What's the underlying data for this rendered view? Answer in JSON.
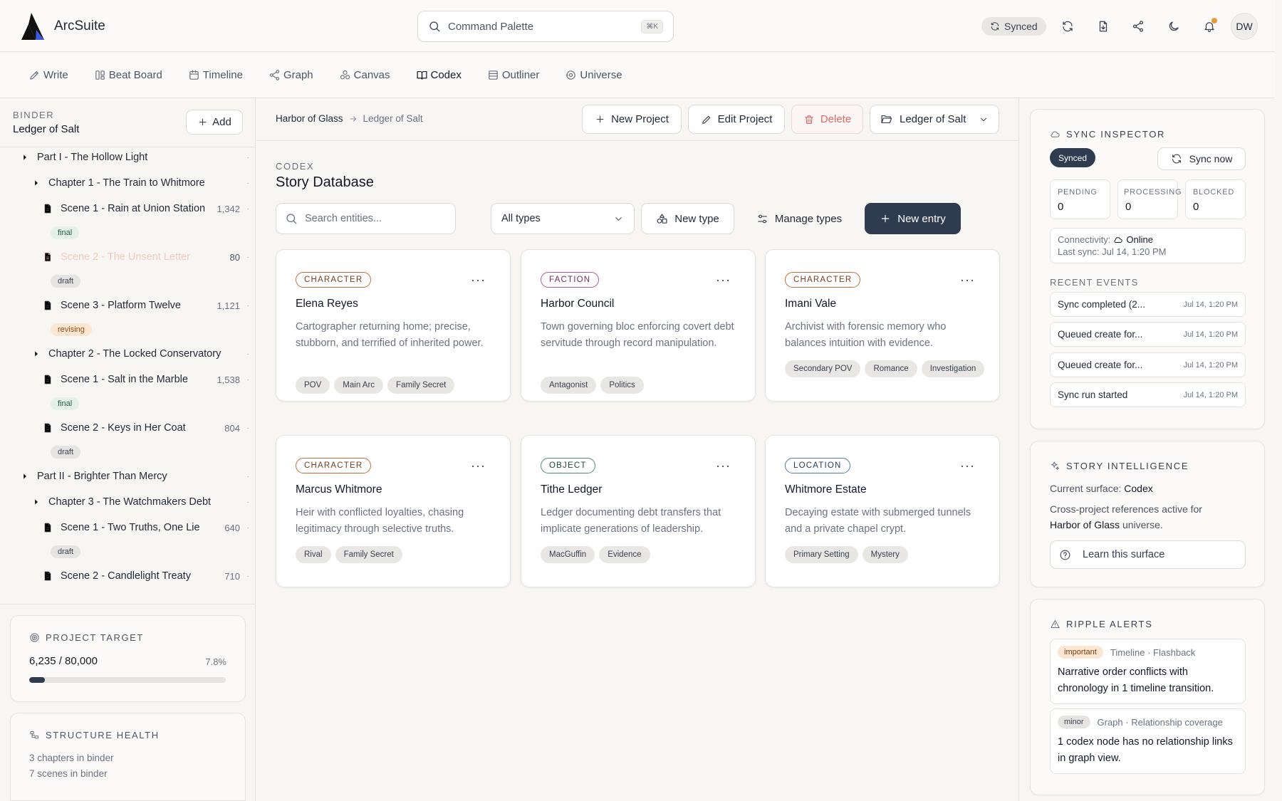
{
  "app": {
    "name": "ArcSuite",
    "user_initials": "DW",
    "sync_status": "Synced"
  },
  "command_palette": {
    "label": "Command Palette",
    "shortcut": "⌘K"
  },
  "nav": {
    "tabs": [
      {
        "label": "Write",
        "icon": "pen-icon"
      },
      {
        "label": "Beat Board",
        "icon": "board-icon"
      },
      {
        "label": "Timeline",
        "icon": "calendar-icon"
      },
      {
        "label": "Graph",
        "icon": "graph-icon"
      },
      {
        "label": "Canvas",
        "icon": "canvas-icon"
      },
      {
        "label": "Codex",
        "icon": "book-icon",
        "active": true
      },
      {
        "label": "Outliner",
        "icon": "outline-icon"
      },
      {
        "label": "Universe",
        "icon": "universe-icon"
      }
    ]
  },
  "binder": {
    "label": "BINDER",
    "title": "Ledger of Salt",
    "add_label": "Add",
    "items": [
      {
        "label": "Part I - The Hollow Light"
      },
      {
        "label": "Chapter 1 - The Train to Whitmore"
      },
      {
        "label": "Scene 1 - Rain at Union Station",
        "count": "1,342",
        "status": "final"
      },
      {
        "label": "Scene 2 - The Unsent Letter",
        "count": "80",
        "status": "draft"
      },
      {
        "label": "Scene 3 - Platform Twelve",
        "count": "1,121",
        "status": "revising"
      },
      {
        "label": "Chapter 2 - The Locked Conservatory"
      },
      {
        "label": "Scene 1 - Salt in the Marble",
        "count": "1,538",
        "status": "final"
      },
      {
        "label": "Scene 2 - Keys in Her Coat",
        "count": "804",
        "status": "draft"
      },
      {
        "label": "Part II - Brighter Than Mercy"
      },
      {
        "label": "Chapter 3 - The Watchmakers Debt"
      },
      {
        "label": "Scene 1 - Two Truths, One Lie",
        "count": "640",
        "status": "draft"
      },
      {
        "label": "Scene 2 - Candlelight Treaty",
        "count": "710"
      }
    ],
    "dot": "·",
    "project_target": {
      "title": "PROJECT TARGET",
      "progress": "6,235 / 80,000",
      "percent": "7.8%",
      "fraction": 0.078
    },
    "structure_health": {
      "title": "STRUCTURE HEALTH",
      "chapters": "3 chapters in binder",
      "scenes": "7 scenes in binder"
    }
  },
  "main": {
    "breadcrumb": {
      "root": "Harbor of Glass",
      "current": "Ledger of Salt"
    },
    "toolbar": {
      "new_project": "New Project",
      "edit_project": "Edit Project",
      "delete": "Delete",
      "project_select": "Ledger of Salt"
    },
    "eyebrow": "CODEX",
    "title": "Story Database",
    "search_placeholder": "Search entities...",
    "type_filter": "All types",
    "new_type": "New type",
    "manage_types": "Manage types",
    "new_entry": "New entry",
    "more": "···",
    "cards": [
      {
        "type": "CHARACTER",
        "kind": "character",
        "name": "Elena Reyes",
        "desc": "Cartographer returning home; precise, stubborn, and terrified of inherited power.",
        "tags": [
          "POV",
          "Main Arc",
          "Family Secret"
        ]
      },
      {
        "type": "FACTION",
        "kind": "faction",
        "name": "Harbor Council",
        "desc": "Town governing bloc enforcing covert debt servitude through record manipulation.",
        "tags": [
          "Antagonist",
          "Politics"
        ]
      },
      {
        "type": "CHARACTER",
        "kind": "character",
        "name": "Imani Vale",
        "desc": "Archivist with forensic memory who balances intuition with evidence.",
        "tags": [
          "Secondary POV",
          "Romance",
          "Investigation"
        ]
      },
      {
        "type": "CHARACTER",
        "kind": "character",
        "name": "Marcus Whitmore",
        "desc": "Heir with conflicted loyalties, chasing legitimacy through selective truths.",
        "tags": [
          "Rival",
          "Family Secret"
        ]
      },
      {
        "type": "OBJECT",
        "kind": "object",
        "name": "Tithe Ledger",
        "desc": "Ledger documenting debt transfers that implicate generations of leadership.",
        "tags": [
          "MacGuffin",
          "Evidence"
        ]
      },
      {
        "type": "LOCATION",
        "kind": "location",
        "name": "Whitmore Estate",
        "desc": "Decaying estate with submerged tunnels and a private chapel crypt.",
        "tags": [
          "Primary Setting",
          "Mystery"
        ]
      }
    ]
  },
  "sync_inspector": {
    "title": "SYNC INSPECTOR",
    "status": "Synced",
    "sync_now": "Sync now",
    "stats": [
      {
        "label": "PENDING",
        "value": "0"
      },
      {
        "label": "PROCESSING",
        "value": "0"
      },
      {
        "label": "BLOCKED",
        "value": "0"
      }
    ],
    "connectivity_label": "Connectivity:",
    "connectivity_value": "Online",
    "last_sync": "Last sync: Jul 14, 1:20 PM",
    "recent_label": "RECENT EVENTS",
    "events": [
      {
        "label": "Sync completed (2...",
        "time": "Jul 14, 1:20 PM"
      },
      {
        "label": "Queued create for...",
        "time": "Jul 14, 1:20 PM"
      },
      {
        "label": "Queued create for...",
        "time": "Jul 14, 1:20 PM"
      },
      {
        "label": "Sync run started",
        "time": "Jul 14, 1:20 PM"
      }
    ]
  },
  "story_intelligence": {
    "title": "STORY INTELLIGENCE",
    "surface_label": "Current surface:",
    "surface_value": "Codex",
    "cross_text": "Cross-project references active for",
    "universe": "Harbor of Glass",
    "universe_suffix": "universe.",
    "learn": "Learn this surface"
  },
  "ripple_alerts": {
    "title": "RIPPLE ALERTS",
    "alerts": [
      {
        "severity": "important",
        "source": "Timeline · Flashback",
        "text": "Narrative order conflicts with chronology in 1 timeline transition."
      },
      {
        "severity": "minor",
        "source": "Graph · Relationship coverage",
        "text": "1 codex node has no relationship links in graph view."
      }
    ]
  }
}
